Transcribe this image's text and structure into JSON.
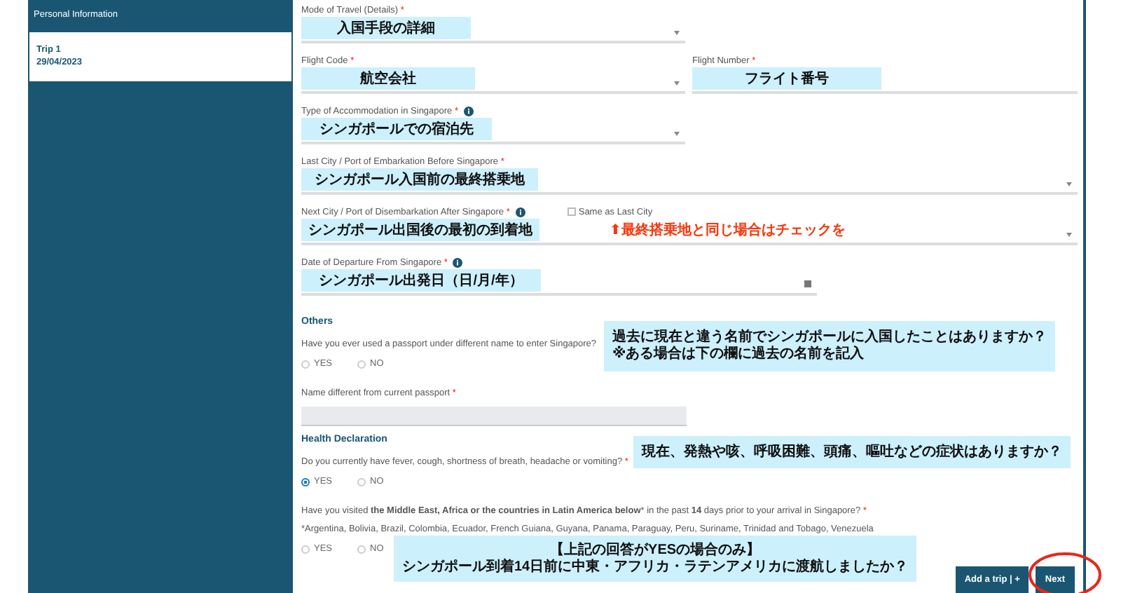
{
  "sidebar": {
    "items": [
      {
        "label": "Personal Information",
        "selected": false
      },
      {
        "label": "Trip 1",
        "sublabel": "29/04/2023",
        "selected": true
      }
    ]
  },
  "trip_fields": [
    {
      "label": "Mode of Travel (Details)",
      "required_mark": "*",
      "kind": "select",
      "annotation": "入国手段の詳細"
    },
    {
      "label": "Flight Code",
      "required_mark": "*",
      "kind": "select",
      "annotation": "航空会社"
    },
    {
      "label": "Flight Number",
      "required_mark": "*",
      "kind": "text",
      "annotation": "フライト番号"
    },
    {
      "label": "Type of Accommodation in Singapore",
      "required_mark": "*",
      "info": true,
      "kind": "select",
      "annotation": "シンガポールでの宿泊先"
    },
    {
      "label": "Last City / Port of Embarkation Before Singapore",
      "required_mark": "*",
      "kind": "select",
      "annotation": "シンガポール入国前の最終搭乗地"
    },
    {
      "label": "Next City / Port of Disembarkation After Singapore",
      "required_mark": "*",
      "info": true,
      "kind": "select",
      "annotation": "シンガポール出国後の最初の到着地",
      "same_as_last": {
        "label": "Same as Last City",
        "checked": false
      },
      "note": "⬆最終搭乗地と同じ場合はチェックを"
    },
    {
      "label": "Date of Departure From Singapore",
      "required_mark": "*",
      "info": true,
      "kind": "date",
      "annotation": "シンガポール出発日（日/月/年）"
    }
  ],
  "others": {
    "heading": "Others",
    "question": "Have you ever used a passport under different name to enter Singapore?",
    "options": [
      {
        "label": "YES",
        "selected": false
      },
      {
        "label": "NO",
        "selected": false
      }
    ],
    "annotation": [
      "過去に現在と違う名前でシンガポールに入国したことはありますか？",
      "※ある場合は下の欄に過去の名前を記入"
    ],
    "name_field": {
      "label": "Name different from current passport",
      "required_mark": "*",
      "disabled": true
    }
  },
  "health": {
    "heading": "Health Declaration",
    "questions": [
      {
        "text": "Do you currently have fever, cough, shortness of breath, headache or vomiting?",
        "required_mark": "*",
        "options": [
          {
            "label": "YES",
            "selected": true
          },
          {
            "label": "NO",
            "selected": false
          }
        ],
        "annotation": [
          "現在、発熱や咳、呼吸困難、頭痛、嘔吐などの症状はありますか？"
        ]
      },
      {
        "text": "Have you visited **the Middle East, Africa or the countries in Latin America below*** in the past **14** days prior to your arrival in Singapore?",
        "required_mark": "*",
        "detail": "*Argentina, Bolivia, Brazil, Colombia, Ecuador, French Guiana, Guyana, Panama, Paraguay, Peru, Suriname, Trinidad and Tobago, Venezuela",
        "options": [
          {
            "label": "YES",
            "selected": false
          },
          {
            "label": "NO",
            "selected": false
          }
        ],
        "annotation": [
          "【上記の回答がYESの場合のみ】",
          "シンガポール到着14日前に中東・アフリカ・ラテンアメリカに渡航しましたか？"
        ]
      }
    ]
  },
  "buttons": [
    {
      "label": "Add a trip | +",
      "kind": "secondary"
    },
    {
      "label": "Next",
      "kind": "primary",
      "highlighted": true
    }
  ]
}
